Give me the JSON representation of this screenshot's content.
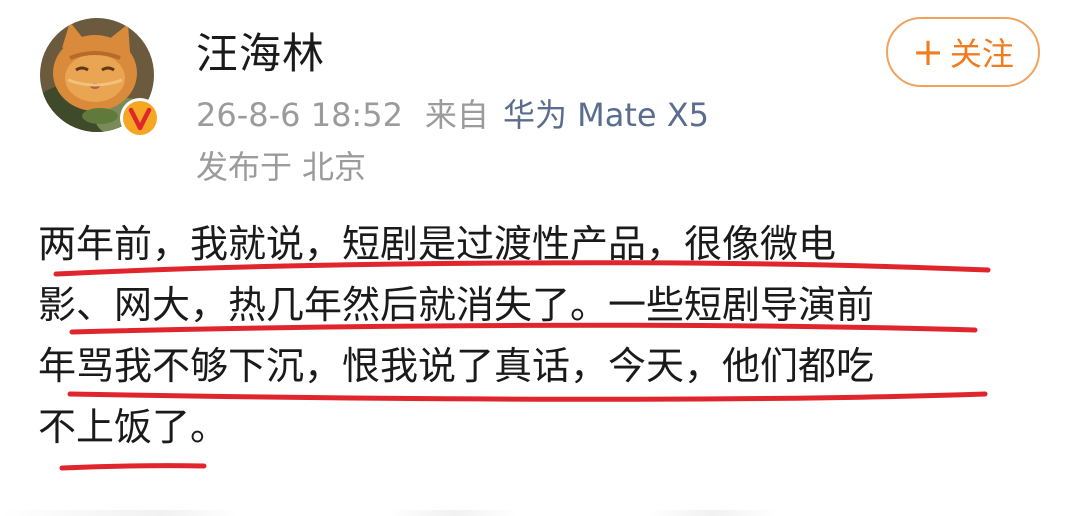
{
  "user": {
    "name": "汪海林",
    "avatar_icon": "cat-avatar",
    "verified_icon": "verified-v-badge"
  },
  "meta": {
    "timestamp": "26-8-6 18:52",
    "from_label": "来自",
    "device": "华为 Mate X5",
    "location_label": "发布于",
    "location": "北京"
  },
  "follow_button": {
    "plus": "+",
    "label": "关注"
  },
  "post": {
    "lines": [
      "两年前，我就说，短剧是过渡性产品，很像微电",
      "影、网大，热几年然后就消失了。一些短剧导演前",
      "年骂我不够下沉，恨我说了真话，今天，他们都吃",
      "不上饭了。"
    ]
  },
  "colors": {
    "accent": "#f07c1e",
    "underline": "#e0262c",
    "device_link": "#5a6d8e",
    "meta_text": "#9b9b9b",
    "verified": "#f5a623"
  }
}
